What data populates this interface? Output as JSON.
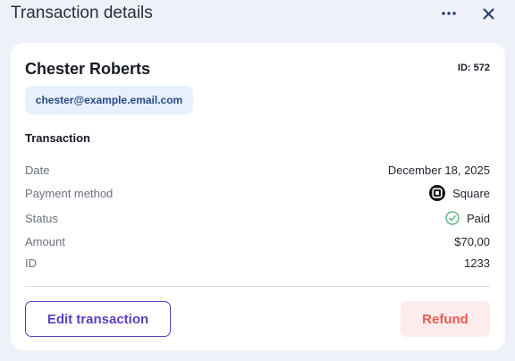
{
  "header": {
    "title": "Transaction details",
    "more_icon": "more-horizontal-icon",
    "close_icon": "close-icon"
  },
  "customer": {
    "name": "Chester Roberts",
    "id_label": "ID: 572",
    "email": "chester@example.email.com"
  },
  "transaction": {
    "section_title": "Transaction",
    "rows": [
      {
        "label": "Date",
        "value": "December 18, 2025"
      },
      {
        "label": "Payment method",
        "value": "Square",
        "icon": "square-logo-icon"
      },
      {
        "label": "Status",
        "value": "Paid",
        "icon": "check-circle-icon"
      },
      {
        "label": "Amount",
        "value": "$70,00"
      },
      {
        "label": "ID",
        "value": "1233"
      }
    ]
  },
  "actions": {
    "edit_label": "Edit transaction",
    "refund_label": "Refund"
  },
  "colors": {
    "background": "#eef1f8",
    "accent": "#5a3fc0",
    "danger": "#ec5a50",
    "danger_bg": "#fdeceb",
    "chip_bg": "#e8f0fd",
    "success": "#3fae6a"
  }
}
